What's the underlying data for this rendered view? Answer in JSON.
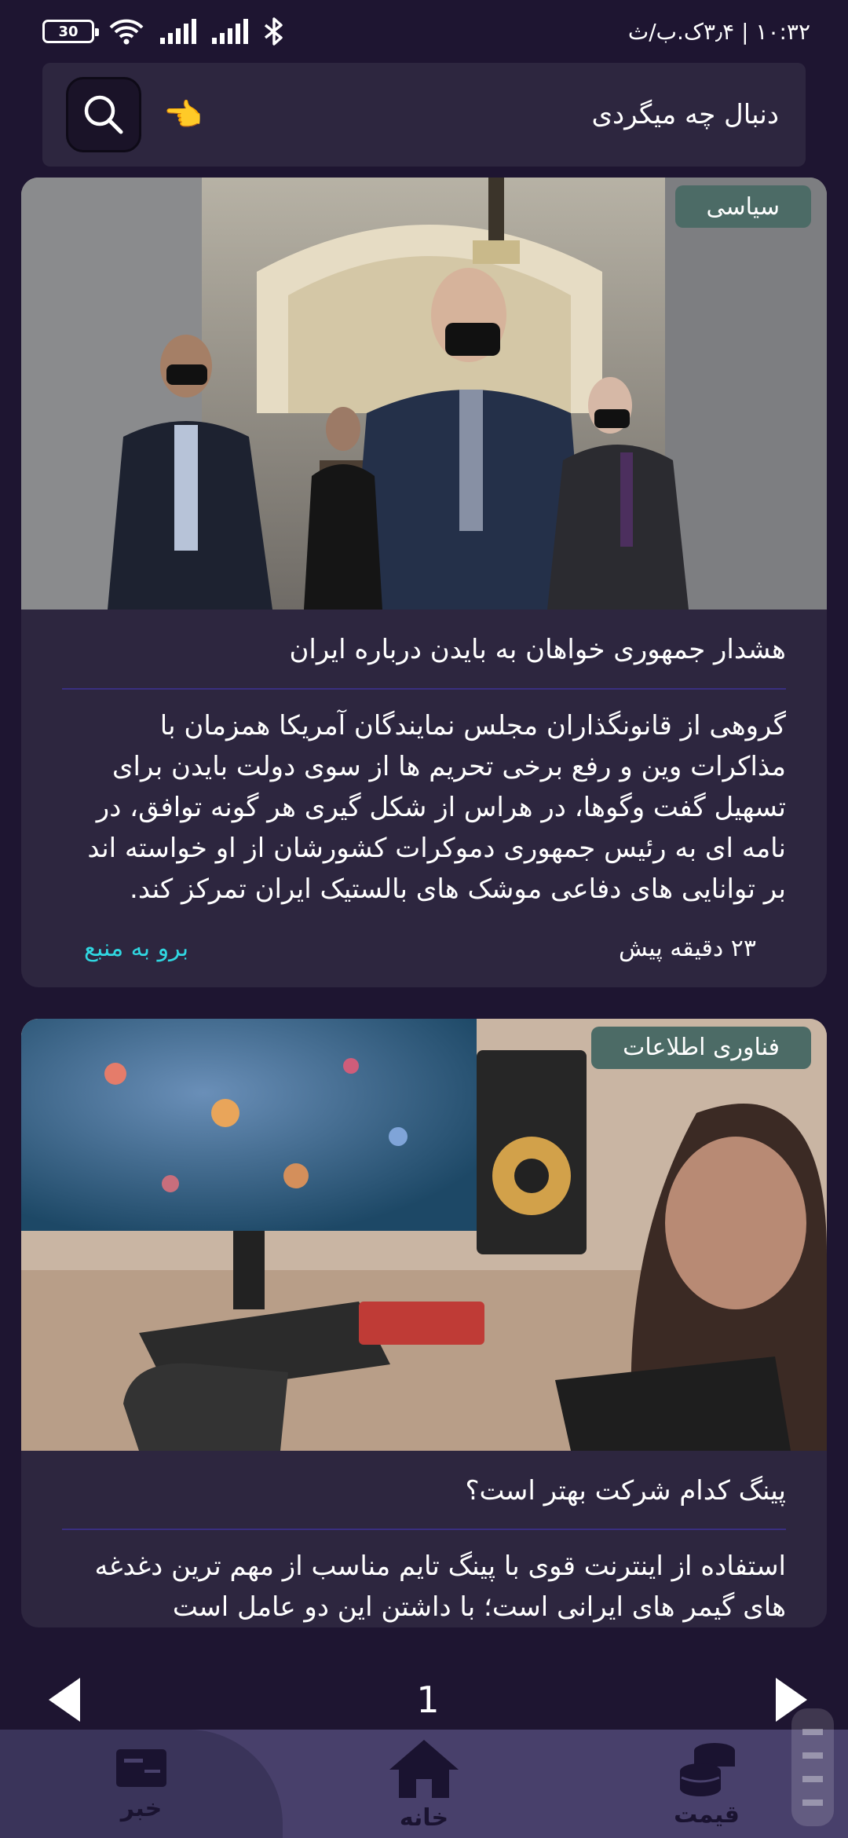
{
  "status_bar": {
    "battery": "30",
    "time_data": "۱۰:۳۲ | ۳٫۴ک.ب/ث"
  },
  "search": {
    "placeholder": "دنبال چه میگردی",
    "hand_emoji": "👈"
  },
  "news": [
    {
      "category": "سیاسی",
      "title": "هشدار جمهوری خواهان به بایدن درباره ایران",
      "body": "گروهی از قانونگذاران مجلس نمایندگان آمریکا همزمان با مذاکرات وین و رفع برخی تحریم ها از سوی دولت بایدن برای تسهیل گفت وگوها، در هراس از شکل گیری هر گونه توافق، در نامه ای به رئیس جمهوری دموکرات کشورشان از او خواسته اند بر توانایی های دفاعی موشک های بالستیک ایران تمرکز کند.",
      "time_ago": "۲۳ دقیقه پیش",
      "source_link": "برو به منبع"
    },
    {
      "category": "فناوری اطلاعات",
      "title": "پینگ کدام شرکت بهتر است؟",
      "body": "استفاده از اینترنت قوی با پینگ تایم مناسب از مهم ترین دغدغه های گیمر های ایرانی است؛ با داشتن این دو عامل است"
    }
  ],
  "pager": {
    "page": "1"
  },
  "bottom_nav": {
    "items": [
      {
        "label": "خبر",
        "icon": "newspaper-icon",
        "active": true
      },
      {
        "label": "خانه",
        "icon": "home-icon",
        "active": false
      },
      {
        "label": "قیمت",
        "icon": "coins-icon",
        "active": false
      }
    ]
  },
  "colors": {
    "background": "#1e1531",
    "card": "#2d263f",
    "badge": "#4c6b66",
    "link": "#30d6e0",
    "nav": "#48406b"
  }
}
